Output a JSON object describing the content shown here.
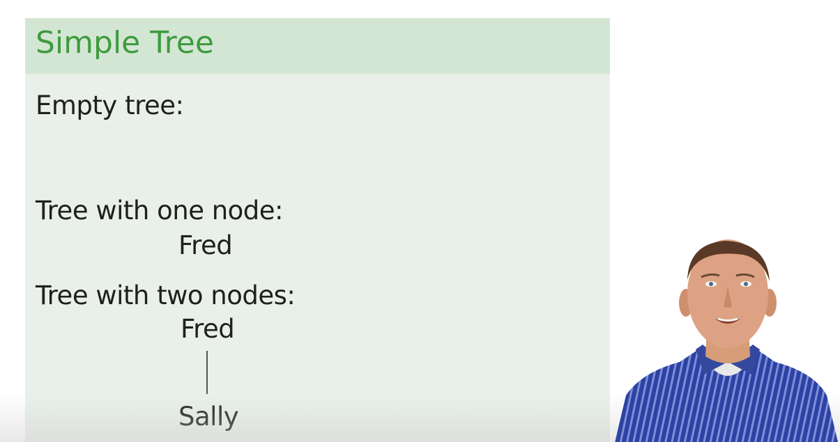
{
  "slide": {
    "title": "Simple Tree",
    "empty_label": "Empty tree:",
    "one_node_label": "Tree with one node:",
    "one_node_tree": {
      "root": "Fred"
    },
    "two_node_label": "Tree with two nodes:",
    "two_node_tree": {
      "root": "Fred",
      "child": "Sally"
    }
  },
  "colors": {
    "header_bg": "#d3e6d3",
    "title_text": "#3f9b3f",
    "body_bg": "#e9f0e9",
    "body_text": "#1f1f1f",
    "shirt": "#2b3f9e"
  }
}
